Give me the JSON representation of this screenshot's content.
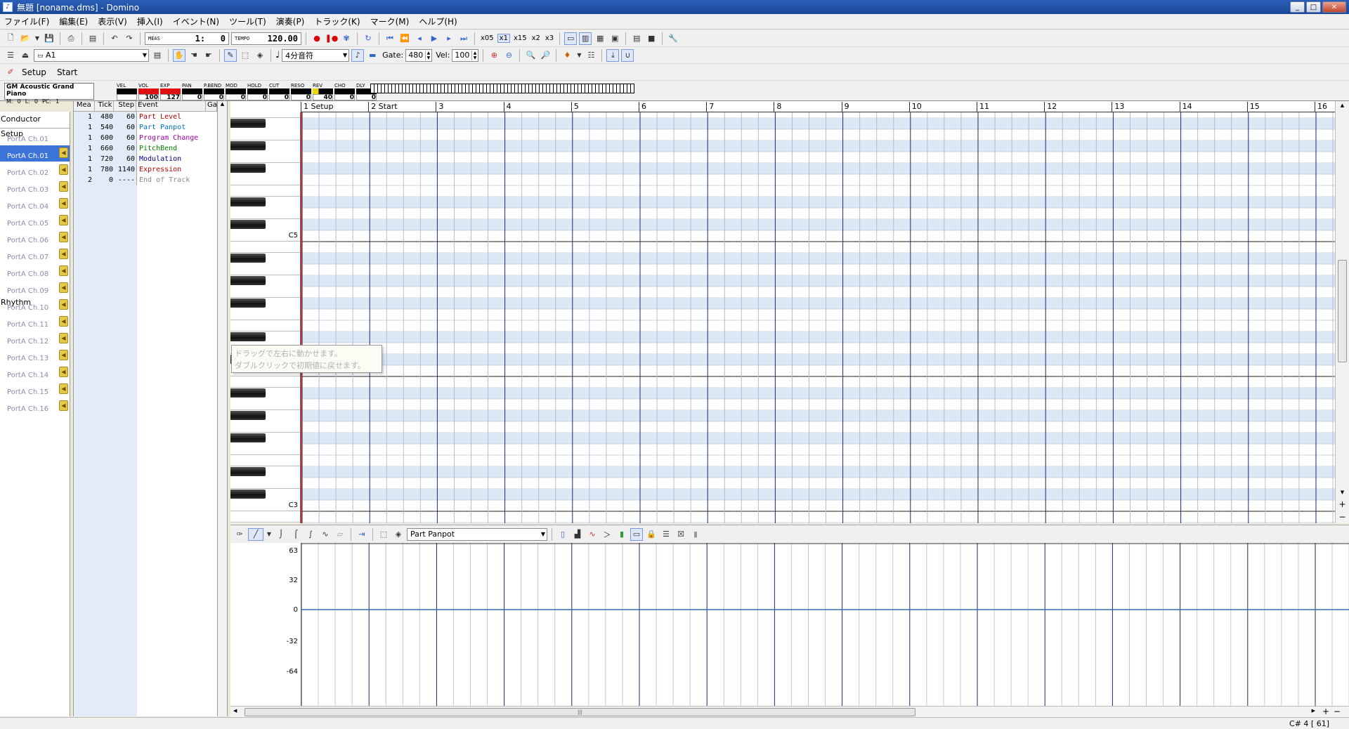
{
  "window": {
    "title": "無題 [noname.dms] - Domino"
  },
  "menu": [
    "ファイル(F)",
    "編集(E)",
    "表示(V)",
    "挿入(I)",
    "イベント(N)",
    "ツール(T)",
    "演奏(P)",
    "トラック(K)",
    "マーク(M)",
    "ヘルプ(H)"
  ],
  "toolbar": {
    "meas_label": "MEAS",
    "position": "1:   0",
    "tempo_label": "TEMPO",
    "tempo": "120.00",
    "zoom_options": [
      "x05",
      "x1",
      "x15",
      "x2",
      "x3"
    ],
    "zoom_selected": "x1",
    "track_select": "A1",
    "note_length": "4分音符",
    "gate_label": "Gate:",
    "gate_value": "480",
    "vel_label": "Vel:",
    "vel_value": "100",
    "tabs": [
      "Setup",
      "Start"
    ]
  },
  "instrument": {
    "name": "GM Acoustic Grand Piano",
    "m_label": "M:",
    "m_value": "0",
    "l_label": "L:",
    "l_value": "0",
    "pc_label": "PC:",
    "pc_value": "1",
    "controllers": [
      {
        "label": "VEL",
        "value": "",
        "style": "black"
      },
      {
        "label": "VOL",
        "value": "100",
        "style": "red"
      },
      {
        "label": "EXP",
        "value": "127",
        "style": "red"
      },
      {
        "label": "PAN",
        "value": "0",
        "style": "black"
      },
      {
        "label": "P.BEND",
        "value": "0",
        "style": "black"
      },
      {
        "label": "MOD",
        "value": "0",
        "style": "black"
      },
      {
        "label": "HOLD",
        "value": "0",
        "style": "black"
      },
      {
        "label": "CUT",
        "value": "0",
        "style": "black"
      },
      {
        "label": "RESO",
        "value": "0",
        "style": "black"
      },
      {
        "label": "REV",
        "value": "40",
        "style": "yel"
      },
      {
        "label": "CHO",
        "value": "0",
        "style": "black"
      },
      {
        "label": "DLY",
        "value": "0",
        "style": "black"
      }
    ]
  },
  "tracks": {
    "conductor": "Conductor",
    "setup_group": "Setup",
    "rhythm_group": "Rhythm",
    "items": [
      "PortA  Ch.01",
      "PortA  Ch.01",
      "PortA  Ch.02",
      "PortA  Ch.03",
      "PortA  Ch.04",
      "PortA  Ch.05",
      "PortA  Ch.06",
      "PortA  Ch.07",
      "PortA  Ch.08",
      "PortA  Ch.09",
      "PortA  Ch.10",
      "PortA  Ch.11",
      "PortA  Ch.12",
      "PortA  Ch.13",
      "PortA  Ch.14",
      "PortA  Ch.15",
      "PortA  Ch.16"
    ],
    "selected_index": 1
  },
  "eventlist": {
    "headers": [
      "Mea",
      "Tick",
      "Step",
      "Event",
      "Ga"
    ],
    "rows": [
      {
        "mea": "1",
        "tick": "480",
        "step": "60",
        "event": "Part Level",
        "color": "#b00000"
      },
      {
        "mea": "1",
        "tick": "540",
        "step": "60",
        "event": "Part Panpot",
        "color": "#0070c0"
      },
      {
        "mea": "1",
        "tick": "600",
        "step": "60",
        "event": "Program Change",
        "color": "#a000a0"
      },
      {
        "mea": "1",
        "tick": "660",
        "step": "60",
        "event": "PitchBend",
        "color": "#008000"
      },
      {
        "mea": "1",
        "tick": "720",
        "step": "60",
        "event": "Modulation",
        "color": "#000080"
      },
      {
        "mea": "1",
        "tick": "780",
        "step": "1140",
        "event": "Expression",
        "color": "#c00000"
      },
      {
        "mea": "2",
        "tick": "0",
        "step": "----",
        "event": "End of Track",
        "color": "#8a8a8a"
      }
    ]
  },
  "pianoroll": {
    "measures": [
      "1 Setup",
      "2 Start",
      "3",
      "4",
      "5",
      "6",
      "7",
      "8",
      "9",
      "10",
      "11",
      "12",
      "13",
      "14",
      "15",
      "16"
    ],
    "octave_labels": [
      "C5",
      "C4",
      "C3"
    ]
  },
  "tooltip": {
    "line1": "ドラッグで左右に動かせます。",
    "line2": "ダブルクリックで初期値に戻せます。"
  },
  "controller": {
    "selected": "Part Panpot",
    "scale": [
      "63",
      "32",
      "0",
      "-32",
      "-64"
    ]
  },
  "status": {
    "text": "C# 4 [ 61]"
  },
  "colors": {
    "title_bar": "#1b4797",
    "selected_track": "#3d74d9",
    "grid_line": "#1a2a6a",
    "cursor_line": "#c03030"
  }
}
